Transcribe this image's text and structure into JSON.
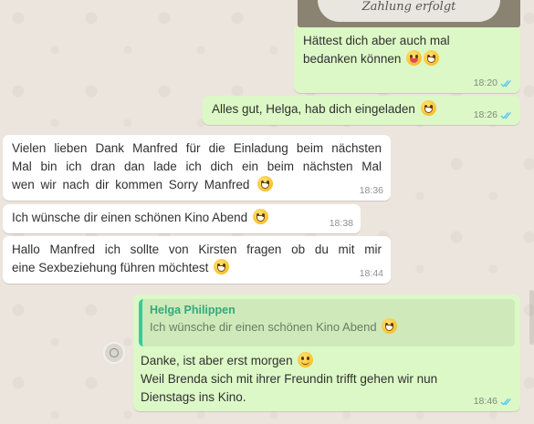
{
  "photo": {
    "caption": "Zahlung erfolgt"
  },
  "messages": [
    {
      "lines": [
        "Hättest dich aber auch mal",
        "bedanken können"
      ],
      "time": "18:20",
      "status": "read",
      "emoji": [
        "tongue",
        "laugh"
      ]
    },
    {
      "text": "Alles gut, Helga, hab dich eingeladen",
      "time": "18:26",
      "status": "read",
      "emoji": [
        "grin"
      ]
    },
    {
      "lines": [
        "Vielen lieben Dank Manfred für die Einladung beim nächsten",
        "Mal bin ich dran dan lade ich dich ein beim nächsten Mal",
        "wen wir nach dir kommen Sorry Manfred"
      ],
      "time": "18:36",
      "emoji": [
        "grin"
      ]
    },
    {
      "text": "Ich wünsche dir einen schönen Kino Abend",
      "time": "18:38",
      "emoji": [
        "grin"
      ]
    },
    {
      "lines": [
        "Hallo Manfred ich sollte von Kirsten fragen ob du mit mir",
        "eine Sexbeziehung führen möchtest"
      ],
      "time": "18:44",
      "emoji": [
        "grin"
      ]
    },
    {
      "quote": {
        "author": "Helga Philippen",
        "text": "Ich wünsche dir einen schönen Kino Abend"
      },
      "lines": [
        "Danke, ist aber erst morgen",
        "Weil Brenda sich mit ihrer Freundin trifft gehen wir nun",
        "Dienstags ins Kino."
      ],
      "time": "18:46",
      "status": "read",
      "emoji": [
        "smirk"
      ]
    }
  ],
  "colors": {
    "outgoing": "#dcf8c6",
    "incoming": "#ffffff",
    "read_ticks": "#4fc3f7",
    "quote_bar": "#35cd96"
  },
  "icons": {
    "read_status": "double-check-icon",
    "reply_react": "emoji-react-icon"
  }
}
